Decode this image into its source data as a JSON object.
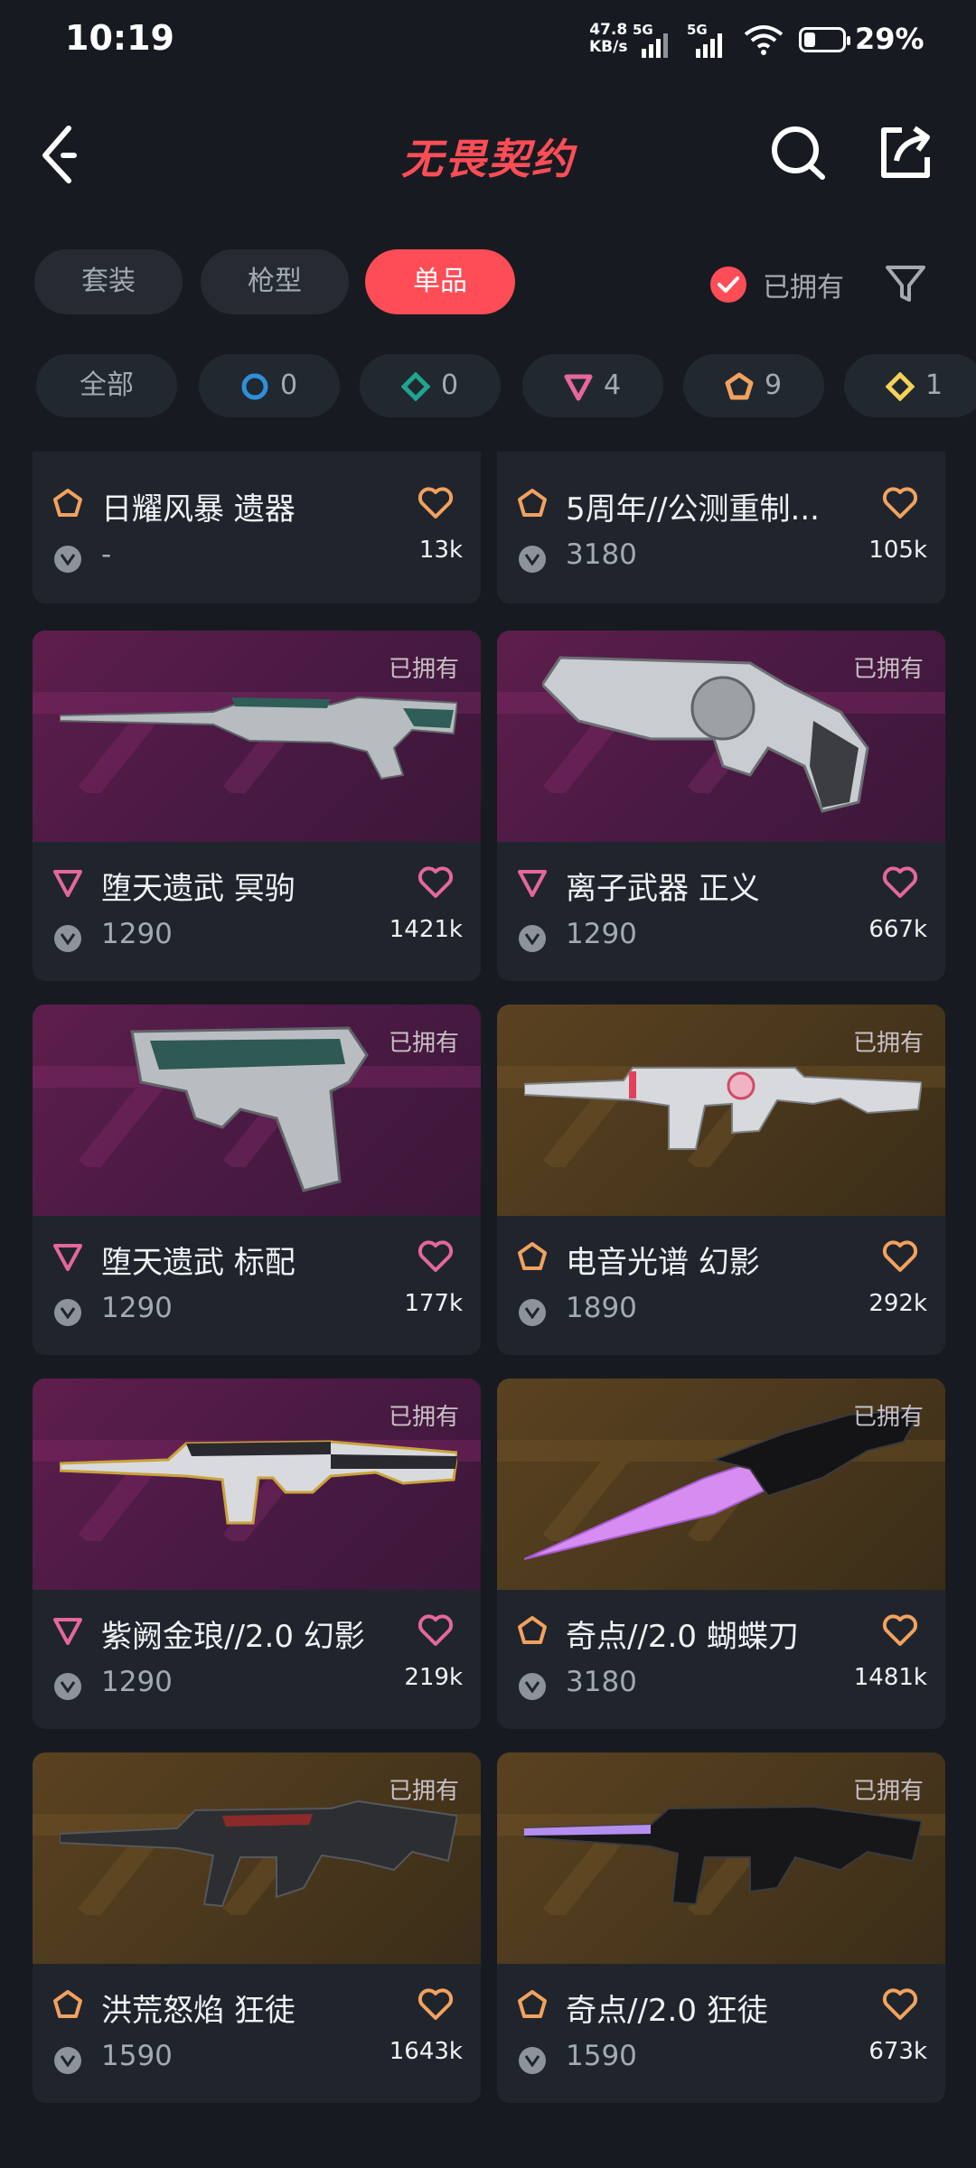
{
  "status_bar": {
    "time": "10:19",
    "net_speed_line1": "47.8",
    "net_speed_line2": "KB/s",
    "sig1_label": "5G",
    "sig2_label": "5G",
    "battery": "29%"
  },
  "header": {
    "title": "无畏契约",
    "title_color": "#ff4d57",
    "back_icon": "chevron-left-icon",
    "search_icon": "search-icon",
    "share_icon": "share-icon"
  },
  "tabs": [
    {
      "label": "套装",
      "active": false
    },
    {
      "label": "枪型",
      "active": false
    },
    {
      "label": "单品",
      "active": true
    }
  ],
  "owned_filter": {
    "label": "已拥有",
    "checked": true
  },
  "rarity_chips": [
    {
      "label": "全部"
    },
    {
      "icon": "blue-circle-icon",
      "count": "0"
    },
    {
      "icon": "teal-diamond-icon",
      "count": "0"
    },
    {
      "icon": "pink-triangle-icon",
      "count": "4"
    },
    {
      "icon": "orange-pentagon-icon",
      "count": "9"
    },
    {
      "icon": "yellow-diamond-icon",
      "count": "1"
    }
  ],
  "items": [
    {
      "name": "日耀风暴 遗器",
      "price": "-",
      "likes": "13k",
      "rarity": "orange",
      "owned": ""
    },
    {
      "name": "5周年//公测重制...",
      "price": "3180",
      "likes": "105k",
      "rarity": "orange",
      "owned": ""
    },
    {
      "name": "堕天遗武 冥驹",
      "price": "1290",
      "likes": "1421k",
      "rarity": "pink",
      "owned": "已拥有"
    },
    {
      "name": "离子武器 正义",
      "price": "1290",
      "likes": "667k",
      "rarity": "pink",
      "owned": "已拥有"
    },
    {
      "name": "堕天遗武 标配",
      "price": "1290",
      "likes": "177k",
      "rarity": "pink",
      "owned": "已拥有"
    },
    {
      "name": "电音光谱 幻影",
      "price": "1890",
      "likes": "292k",
      "rarity": "orange",
      "owned": "已拥有"
    },
    {
      "name": "紫阙金琅//2.0 幻影",
      "price": "1290",
      "likes": "219k",
      "rarity": "pink",
      "owned": "已拥有"
    },
    {
      "name": "奇点//2.0 蝴蝶刀",
      "price": "3180",
      "likes": "1481k",
      "rarity": "orange",
      "owned": "已拥有"
    },
    {
      "name": "洪荒怒焰 狂徒",
      "price": "1590",
      "likes": "1643k",
      "rarity": "orange",
      "owned": "已拥有"
    },
    {
      "name": "奇点//2.0 狂徒",
      "price": "1590",
      "likes": "673k",
      "rarity": "orange",
      "owned": "已拥有"
    }
  ],
  "colors": {
    "accent": "#ff4d57",
    "pink_rarity": "#e5679b",
    "orange_rarity": "#f2a25e",
    "bg": "#171b21",
    "card": "#20252d"
  }
}
